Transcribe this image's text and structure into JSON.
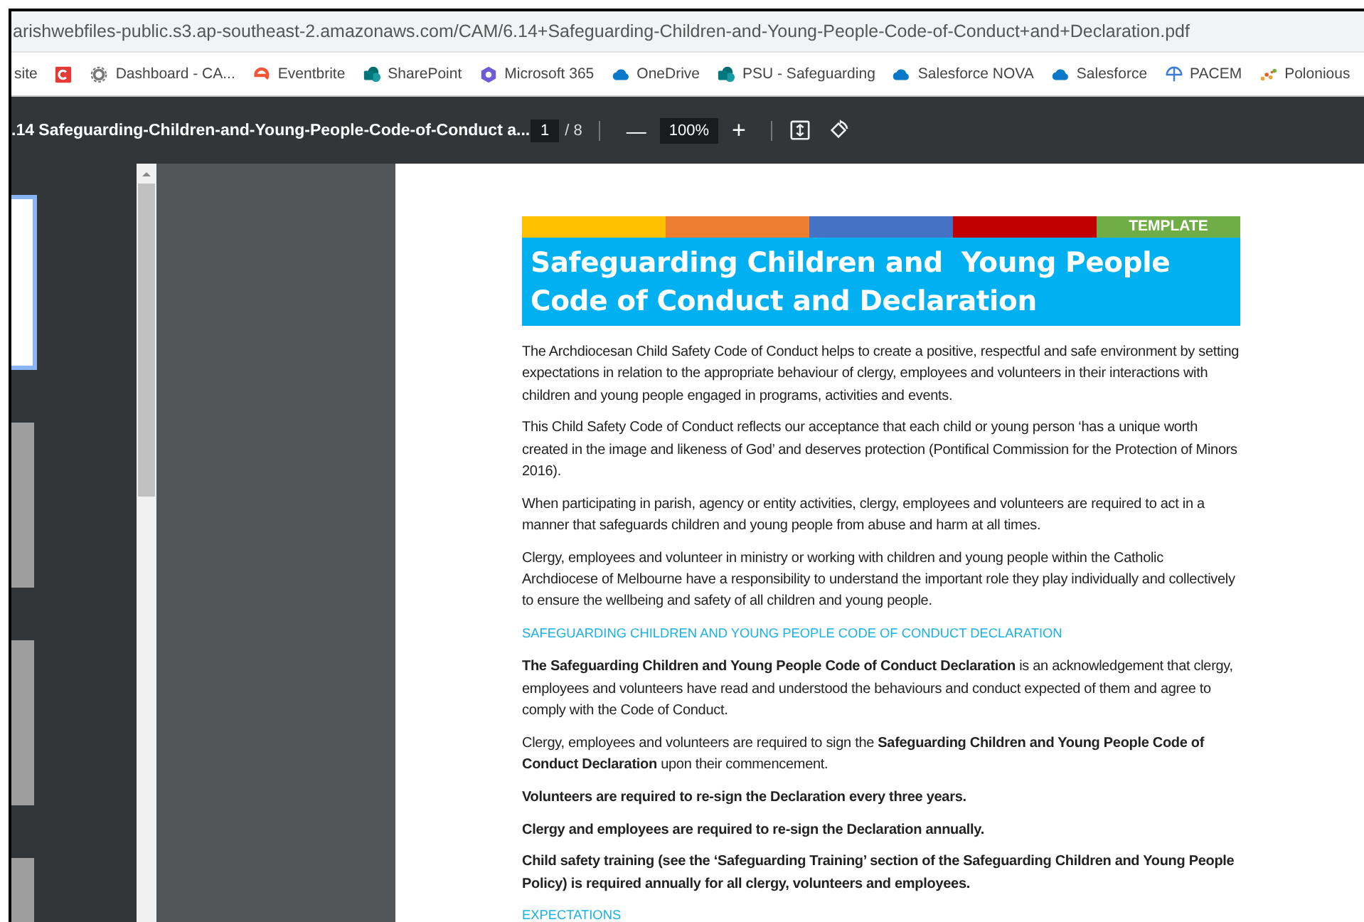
{
  "address_bar": {
    "url": "arishwebfiles-public.s3.ap-southeast-2.amazonaws.com/CAM/6.14+Safeguarding-Children-and-Young-People-Code-of-Conduct+and+Declaration.pdf"
  },
  "bookmarks": [
    {
      "label": "site"
    },
    {
      "label": "Dashboard - CA..."
    },
    {
      "label": "Eventbrite"
    },
    {
      "label": "SharePoint"
    },
    {
      "label": "Microsoft 365"
    },
    {
      "label": "OneDrive"
    },
    {
      "label": "PSU - Safeguarding"
    },
    {
      "label": "Salesforce NOVA"
    },
    {
      "label": "Salesforce"
    },
    {
      "label": "PACEM"
    },
    {
      "label": "Polonious"
    }
  ],
  "pdf_toolbar": {
    "title": ".14 Safeguarding-Children-and-Young-People-Code-of-Conduct a...",
    "page": "1",
    "page_count": "/ 8",
    "zoom_out": "—",
    "zoom": "100%",
    "zoom_in": "+"
  },
  "thumbnails": [
    {
      "selected": true
    },
    {
      "selected": false
    },
    {
      "selected": false
    },
    {
      "selected": false
    }
  ],
  "document": {
    "color_bars": [
      {
        "color": "#ffc000"
      },
      {
        "color": "#ed7d31"
      },
      {
        "color": "#4472c4"
      },
      {
        "color": "#c00000"
      },
      {
        "color": "#70ad47",
        "label": "TEMPLATE"
      }
    ],
    "title_lines": [
      "Safeguarding Children and  Young People",
      "Code of Conduct and Declaration"
    ],
    "blocks": [
      {
        "kind": "paragraph",
        "text": "The Archdiocesan Child Safety Code of Conduct helps to create a positive, respectful and safe environment by setting expectations in relation to the appropriate behaviour of clergy, employees and volunteers in their interactions with children and young people engaged in programs, activities and events."
      },
      {
        "kind": "paragraph",
        "text": "This Child Safety Code of Conduct reflects our acceptance that each child or young person ‘has a unique worth created in the image and likeness of God’ and deserves protection (Pontifical Commission for the Protection of Minors 2016)."
      },
      {
        "kind": "paragraph",
        "text": "When participating in parish, agency or entity activities, clergy, employees and volunteers are required to act in a manner that safeguards children and young people from abuse and harm at all times."
      },
      {
        "kind": "paragraph",
        "text": "Clergy, employees and volunteer in ministry or working with children and young people within the Catholic Archdiocese of Melbourne have a responsibility to understand the important role they play individually and collectively to ensure the wellbeing and safety of all children and young people."
      },
      {
        "kind": "heading",
        "text": "SAFEGUARDING CHILDREN AND YOUNG PEOPLE CODE OF CONDUCT DECLARATION"
      },
      {
        "kind": "paragraph",
        "text": "**The Safeguarding Children and Young People Code of Conduct Declaration** is an acknowledgement that clergy, employees and volunteers have read and understood the behaviours and conduct expected of them and agree to comply with the Code of Conduct."
      },
      {
        "kind": "paragraph",
        "text": "Clergy, employees and volunteers are required to sign the **Safeguarding Children and Young People Code of Conduct Declaration** upon their commencement."
      },
      {
        "kind": "bold_paragraph",
        "text": "Volunteers are required to re-sign the Declaration every three years."
      },
      {
        "kind": "bold_paragraph",
        "text": "Clergy and employees are required to re-sign the Declaration annually."
      },
      {
        "kind": "bold_paragraph",
        "text": "Child safety training (see the ‘Safeguarding Training’ section of the Safeguarding Children and Young People Policy) is required annually for all clergy, volunteers and employees."
      },
      {
        "kind": "heading",
        "text": "EXPECTATIONS"
      }
    ]
  }
}
